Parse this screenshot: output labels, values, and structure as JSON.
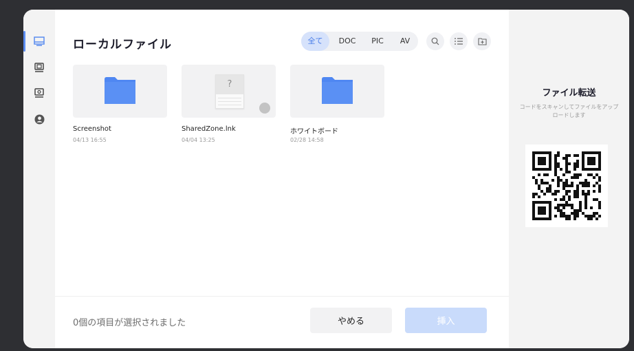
{
  "sidebar": {
    "items": [
      {
        "icon": "monitor-icon",
        "active": true
      },
      {
        "icon": "drive-icon",
        "active": false
      },
      {
        "icon": "usb-drive-icon",
        "active": false
      },
      {
        "icon": "user-icon",
        "active": false
      }
    ]
  },
  "main": {
    "title": "ローカルファイル",
    "filters": [
      "全て",
      "DOC",
      "PIC",
      "AV"
    ],
    "active_filter": "全て",
    "toolbar_icons": [
      "search-icon",
      "list-view-icon",
      "new-folder-icon"
    ],
    "files": [
      {
        "name": "Screenshot",
        "date": "04/13 16:55",
        "type": "folder"
      },
      {
        "name": "SharedZone.lnk",
        "date": "04/04 13:25",
        "type": "unknown",
        "placeholder_glyph": "?"
      },
      {
        "name": "ホワイトボード",
        "date": "02/28 14:58",
        "type": "folder"
      }
    ]
  },
  "footer": {
    "status": "0個の項目が選択されました",
    "cancel_label": "やめる",
    "insert_label": "挿入"
  },
  "transfer_panel": {
    "title": "ファイル転送",
    "description": "コードをスキャンしてファイルをアップロードします"
  },
  "colors": {
    "accent": "#5b8cf0",
    "folder": "#4f87f2",
    "insert_disabled": "#c9dbfb",
    "panel_bg": "#f3f3f3"
  }
}
